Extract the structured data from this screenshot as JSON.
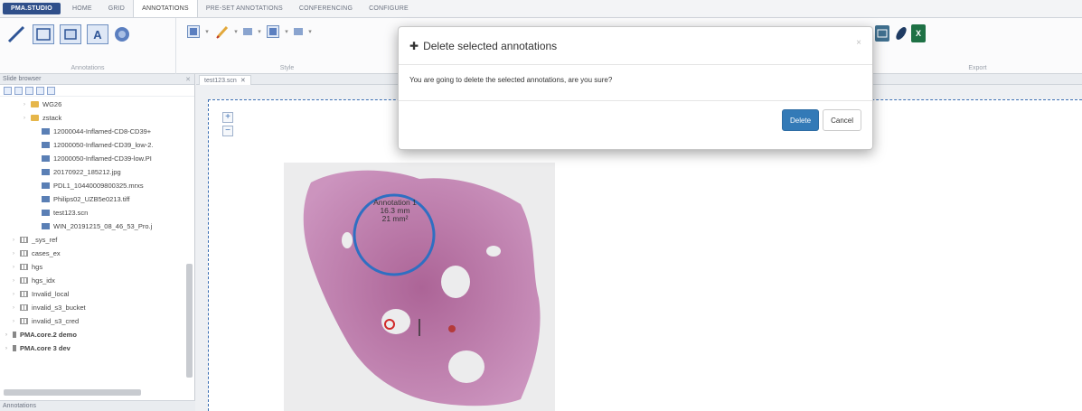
{
  "ribbon_tabs": [
    "PMA.STUDIO",
    "HOME",
    "GRID",
    "ANNOTATIONS",
    "PRE-SET ANNOTATIONS",
    "CONFERENCING",
    "CONFIGURE"
  ],
  "ribbon_groups": {
    "annotations": "Annotations",
    "style": "Style",
    "export": "Export"
  },
  "slide_browser": {
    "title": "Slide browser",
    "items": [
      {
        "label": "WG26",
        "kind": "folder"
      },
      {
        "label": "zstack",
        "kind": "folder"
      },
      {
        "label": "12000044-Inflamed-CD8-CD39+",
        "kind": "slide"
      },
      {
        "label": "12000050-Inflamed-CD39_low-2.",
        "kind": "slide"
      },
      {
        "label": "12000050-Inflamed-CD39-low.PI",
        "kind": "slide"
      },
      {
        "label": "20170922_185212.jpg",
        "kind": "slide"
      },
      {
        "label": "PDL1_10440009800325.mrxs",
        "kind": "slide"
      },
      {
        "label": "Philips02_UZB5e0213.tiff",
        "kind": "slide"
      },
      {
        "label": "test123.scn",
        "kind": "slide"
      },
      {
        "label": "WIN_20191215_08_46_53_Pro.j",
        "kind": "slide"
      },
      {
        "label": "_sys_ref",
        "kind": "root"
      },
      {
        "label": "cases_ex",
        "kind": "root"
      },
      {
        "label": "hgs",
        "kind": "root"
      },
      {
        "label": "hgs_idx",
        "kind": "root"
      },
      {
        "label": "Invalid_local",
        "kind": "root"
      },
      {
        "label": "invalid_s3_bucket",
        "kind": "root"
      },
      {
        "label": "invalid_s3_cred",
        "kind": "root"
      },
      {
        "label": "PMA.core.2 demo",
        "kind": "server"
      },
      {
        "label": "PMA.core 3 dev",
        "kind": "server"
      }
    ],
    "bottom_panel_title": "Annotations"
  },
  "viewer": {
    "tab_label": "test123.scn",
    "zoom_in": "+",
    "zoom_out": "−",
    "annotation_label": [
      "Annotation 1",
      "16.3 mm",
      "21 mm²"
    ]
  },
  "dialog": {
    "title": "Delete selected annotations",
    "close": "×",
    "message": "You are going to delete the selected annotations, are you sure?",
    "confirm_label": "Delete",
    "cancel_label": "Cancel"
  },
  "colors": {
    "primary": "#337ab7",
    "annotation_circle": "#2f6fc2",
    "tissue": "#b05a9a"
  }
}
